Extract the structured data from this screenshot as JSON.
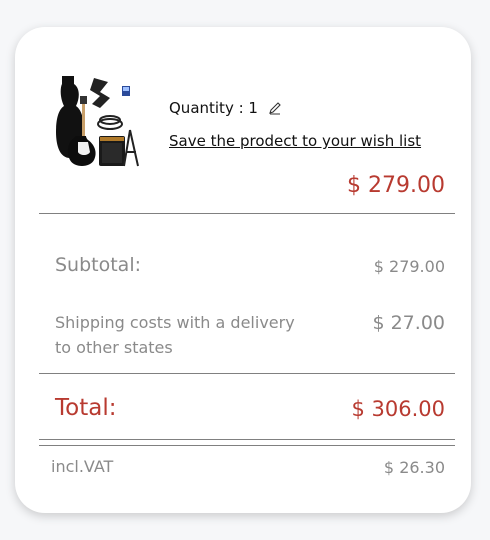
{
  "product": {
    "image_icon": "guitar-bundle-image",
    "quantity_label": "Quantity : 1",
    "edit_icon": "pencil-icon",
    "wishlist_link": "Save the prodect to your wish list",
    "price": "$ 279.00"
  },
  "summary": {
    "subtotal_label": "Subtotal:",
    "subtotal_value": "$ 279.00",
    "shipping_label": "Shipping costs with a delivery to other states",
    "shipping_value": "$ 27.00",
    "total_label": "Total:",
    "total_value": "$ 306.00",
    "vat_label": "incl.VAT",
    "vat_value": "$ 26.30"
  },
  "colors": {
    "accent_red": "#b83a30",
    "muted_text": "#8a8a8a",
    "divider": "#808080"
  }
}
